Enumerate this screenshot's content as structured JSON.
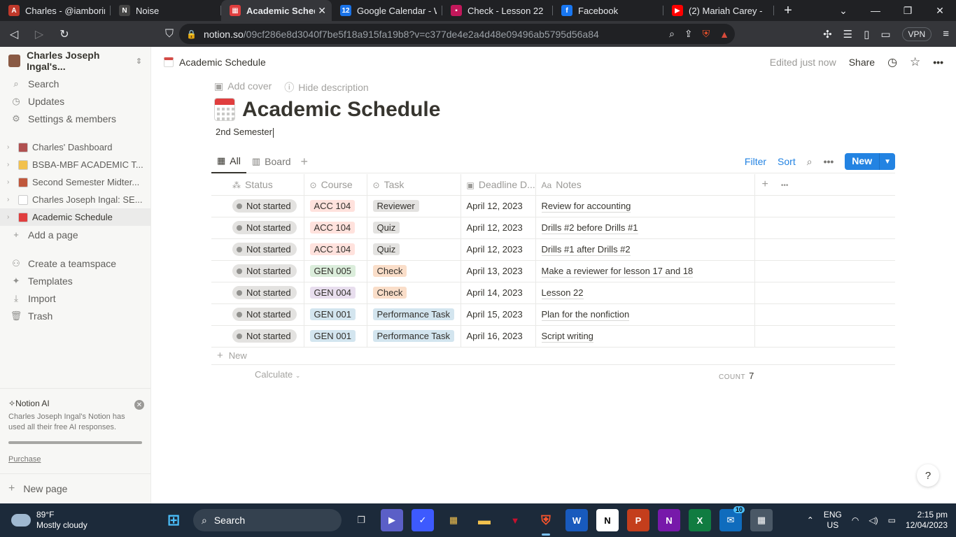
{
  "browser": {
    "tabs": [
      {
        "title": "Charles - @iamboring",
        "color": "#c0392b",
        "glyph": "A"
      },
      {
        "title": "Noise",
        "color": "#444444",
        "glyph": "N"
      },
      {
        "title": "Academic Schedul",
        "color": "#e03e3e",
        "glyph": "▦",
        "active": true
      },
      {
        "title": "Google Calendar - We",
        "color": "#1a73e8",
        "glyph": "12"
      },
      {
        "title": "Check - Lesson 22",
        "color": "#c2185b",
        "glyph": "▪"
      },
      {
        "title": "Facebook",
        "color": "#1877f2",
        "glyph": "f"
      },
      {
        "title": "(2) Mariah Carey -",
        "color": "#ff0000",
        "glyph": "▶"
      }
    ],
    "url_host": "notion.so",
    "url_path": "/09cf286e8d3040f7be5f18a915fa19b8?v=c377de4e2a4d48e09496ab5795d56a84",
    "vpn_label": "VPN"
  },
  "sidebar": {
    "workspace": "Charles Joseph Ingal's...",
    "top_items": [
      {
        "label": "Search",
        "icon": "⌕"
      },
      {
        "label": "Updates",
        "icon": "◷"
      },
      {
        "label": "Settings & members",
        "icon": "⚙"
      }
    ],
    "pages": [
      {
        "label": "Charles' Dashboard",
        "color": "#b05050"
      },
      {
        "label": "BSBA-MBF ACADEMIC T...",
        "color": "#f2c14e"
      },
      {
        "label": "Second Semester Midter...",
        "color": "#c0583c"
      },
      {
        "label": "Charles Joseph Ingal: SE...",
        "color": "#ffffff"
      },
      {
        "label": "Academic Schedule",
        "color": "#e03e3e",
        "active": true
      }
    ],
    "add_page": "Add a page",
    "bottom_items": [
      {
        "label": "Create a teamspace",
        "icon": "⚇"
      },
      {
        "label": "Templates",
        "icon": "✦"
      },
      {
        "label": "Import",
        "icon": "⤓"
      },
      {
        "label": "Trash",
        "icon": "🗑"
      }
    ],
    "ai": {
      "title": "Notion AI",
      "message": "Charles Joseph Ingal's Notion has used all their free AI responses.",
      "link": "Purchase"
    },
    "new_page": "New page"
  },
  "topbar": {
    "breadcrumb": "Academic Schedule",
    "edited": "Edited just now",
    "share": "Share"
  },
  "page": {
    "add_cover": "Add cover",
    "hide_description": "Hide description",
    "title": "Academic Schedule",
    "description": "2nd Semester"
  },
  "views": {
    "tabs": [
      {
        "label": "All",
        "icon": "▦"
      },
      {
        "label": "Board",
        "icon": "▥"
      }
    ],
    "filter": "Filter",
    "sort": "Sort",
    "new": "New"
  },
  "table": {
    "columns": [
      {
        "label": "Status",
        "icon": "⁂"
      },
      {
        "label": "Course",
        "icon": "⊙"
      },
      {
        "label": "Task",
        "icon": "⊙"
      },
      {
        "label": "Deadline D...",
        "icon": "▣"
      },
      {
        "label": "Notes",
        "icon": "Aa"
      }
    ],
    "rows": [
      {
        "status": "Not started",
        "course": "ACC 104",
        "task": "Reviewer",
        "deadline": "April 12, 2023",
        "notes": "Review for accounting"
      },
      {
        "status": "Not started",
        "course": "ACC 104",
        "task": "Quiz",
        "deadline": "April 12, 2023",
        "notes": "Drills #2 before Drills #1"
      },
      {
        "status": "Not started",
        "course": "ACC 104",
        "task": "Quiz",
        "deadline": "April 12, 2023",
        "notes": "Drills #1 after Drills #2"
      },
      {
        "status": "Not started",
        "course": "GEN 005",
        "task": "Check",
        "deadline": "April 13, 2023",
        "notes": "Make a reviewer for lesson 17 and 18"
      },
      {
        "status": "Not started",
        "course": "GEN 004",
        "task": "Check",
        "deadline": "April 14, 2023",
        "notes": "Lesson 22"
      },
      {
        "status": "Not started",
        "course": "GEN 001",
        "task": "Performance Task",
        "deadline": "April 15, 2023",
        "notes": "Plan for the nonfiction"
      },
      {
        "status": "Not started",
        "course": "GEN 001",
        "task": "Performance Task",
        "deadline": "April 16, 2023",
        "notes": "Script writing"
      }
    ],
    "tag_colors": {
      "ACC 104": "#ffe2dd",
      "GEN 005": "#dbeddb",
      "GEN 004": "#e8deee",
      "GEN 001": "#d3e5ef",
      "Reviewer": "#e3e2e0",
      "Quiz": "#e3e2e0",
      "Check": "#fadec9",
      "Performance Task": "#d3e5ef"
    },
    "new_row": "New",
    "calculate": "Calculate",
    "count_label": "COUNT",
    "count_value": "7"
  },
  "help": "?",
  "taskbar": {
    "temperature": "89°F",
    "weather": "Mostly cloudy",
    "search": "Search",
    "language": "ENG",
    "region": "US",
    "time": "2:15 pm",
    "date": "12/04/2023",
    "badge": "10"
  }
}
